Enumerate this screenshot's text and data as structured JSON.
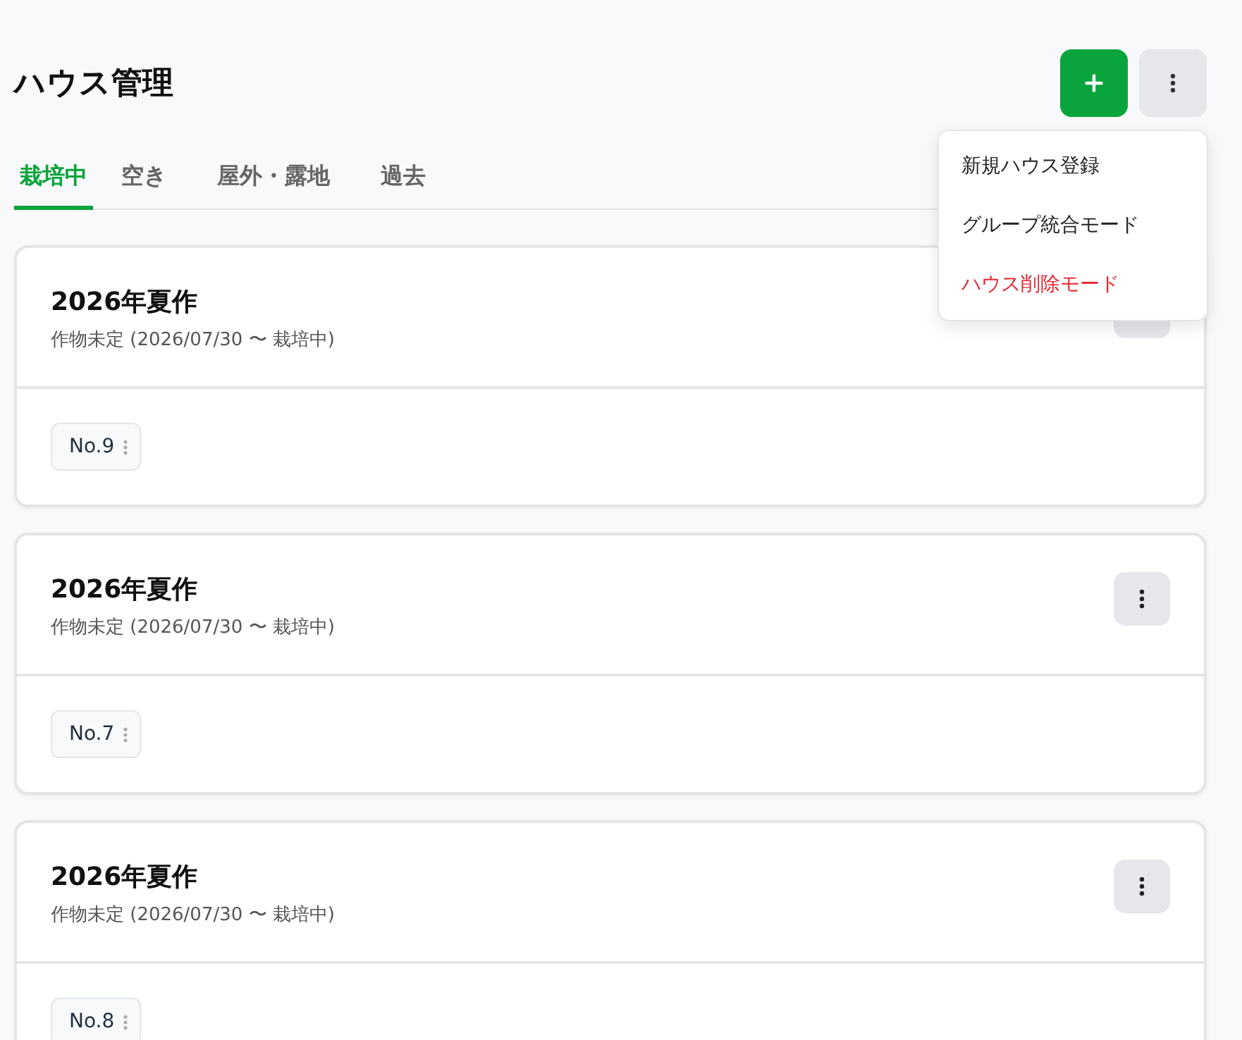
{
  "header": {
    "title": "ハウス管理"
  },
  "tabs": [
    {
      "label": "栽培中",
      "selected": true
    },
    {
      "label": "空き",
      "selected": false
    },
    {
      "label": "屋外・露地",
      "selected": false
    },
    {
      "label": "過去",
      "selected": false
    }
  ],
  "menu": {
    "open": true,
    "items": [
      {
        "label": "新規ハウス登録",
        "kind": "normal"
      },
      {
        "label": "グループ統合モード",
        "kind": "normal"
      },
      {
        "label": "ハウス削除モード",
        "kind": "danger"
      }
    ]
  },
  "cards": [
    {
      "title": "2026年夏作",
      "subtitle": "作物未定 (2026/07/30 〜 栽培中)",
      "houses": [
        "No.9"
      ]
    },
    {
      "title": "2026年夏作",
      "subtitle": "作物未定 (2026/07/30 〜 栽培中)",
      "houses": [
        "No.7"
      ]
    },
    {
      "title": "2026年夏作",
      "subtitle": "作物未定 (2026/07/30 〜 栽培中)",
      "houses": [
        "No.8"
      ]
    }
  ]
}
